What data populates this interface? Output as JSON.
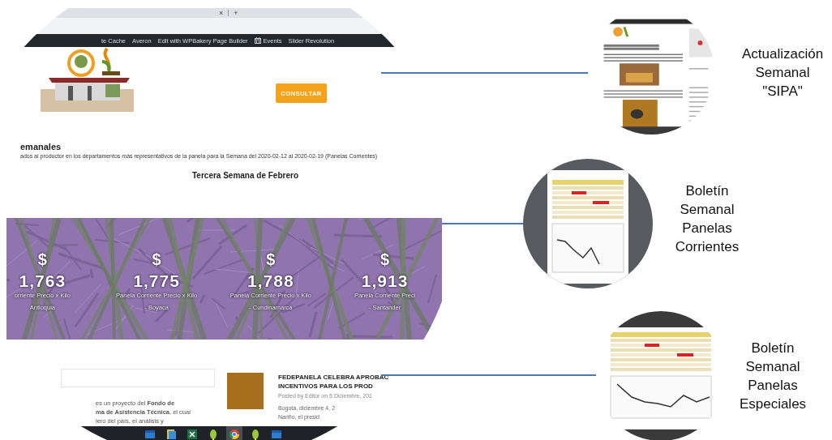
{
  "screenshot": {
    "browser_tab": {
      "close": "×",
      "new_tab": "+"
    },
    "admin_bar": [
      {
        "label": "te Cache",
        "kind": "text"
      },
      {
        "label": "Averon",
        "kind": "text"
      },
      {
        "label": "Edit with WPBakery Page Builder",
        "kind": "text"
      },
      {
        "label": "Events",
        "kind": "calendar"
      },
      {
        "label": "Slider Revolution",
        "kind": "text"
      }
    ],
    "header_button": "CONSULTAR",
    "section_title": "emanales",
    "section_subtitle": "ados al productor en los departamentos más representativos de la panela para la  Semana  del 2020-02-12 al 2020-02-19 (Panelas Corrientes)",
    "week_title": "Tercera Semana de Febrero",
    "stats": [
      {
        "currency": "$",
        "value": "1,763",
        "label": "orriente Precio x Kilo",
        "region": "Antioquia"
      },
      {
        "currency": "$",
        "value": "1,775",
        "label": "Panela Corriente Precio x Kilo",
        "region": "- Boyaca"
      },
      {
        "currency": "$",
        "value": "1,788",
        "label": "Panela Corriente Precio x Kilo",
        "region": "- Cundinamarca"
      },
      {
        "currency": "$",
        "value": "1,913",
        "label": "Panela Corriente Preci",
        "region": "- Santander"
      }
    ],
    "about_lines": [
      "es un proyecto del **Fondo de**",
      "**ma de Asistencia Técnica**, el cual",
      "lero del país, el análisis y"
    ],
    "post": {
      "title_lines": [
        "FEDEPANELA CELEBRA APROBAC",
        "INCENTIVOS PARA LOS PROD"
      ],
      "meta": "Posted by Editor on 5 Diciembre, 201",
      "excerpt_lines": [
        "Bogotá, diciembre 4, 2",
        "Nariño, el presid"
      ]
    },
    "taskbar": [
      {
        "kind": "window",
        "selected": false
      },
      {
        "kind": "files",
        "selected": false
      },
      {
        "kind": "spreadsheet",
        "selected": false
      },
      {
        "kind": "leaf",
        "selected": false
      },
      {
        "kind": "browser",
        "selected": true
      },
      {
        "kind": "leaf",
        "selected": false
      },
      {
        "kind": "window",
        "selected": false
      }
    ]
  },
  "thumbnails": [
    {
      "kind": "webpage",
      "caption": "Actualización Semanal \"SIPA\""
    },
    {
      "kind": "bulletin-framed",
      "caption": "Boletín Semanal Panelas Corrientes"
    },
    {
      "kind": "bulletin",
      "caption": "Boletín Semanal Panelas Especiales"
    }
  ]
}
